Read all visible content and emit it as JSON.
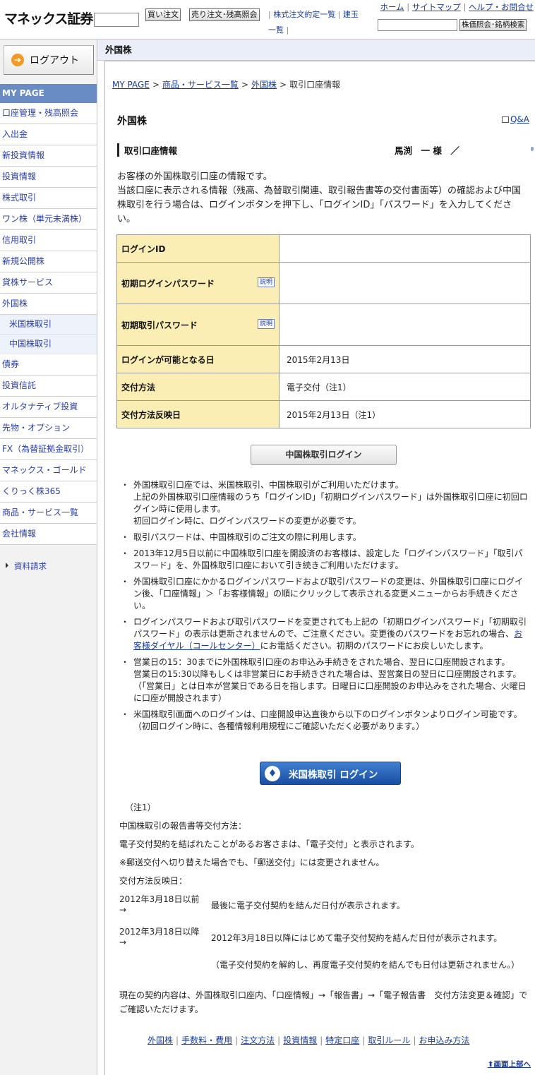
{
  "header": {
    "logo": "マネックス証券",
    "buy_label": "買い注文",
    "sell_label": "売り注文･残高照会",
    "order_list_label": "株式注文約定一覧",
    "contract_label": "建玉一覧",
    "home_label": "ホーム",
    "sitemap_label": "サイトマップ",
    "help_label": "ヘルプ・お問合せ",
    "search_btn_label": "株価照会･銘柄検索"
  },
  "sidebar": {
    "logout_label": "ログアウト",
    "mypage_label": "MY PAGE",
    "items": [
      "口座管理・残高照会",
      "入出金",
      "新投資情報",
      "投資情報",
      "株式取引",
      "ワン株（単元未満株）",
      "信用取引",
      "新規公開株",
      "貸株サービス",
      "外国株"
    ],
    "sub_items": [
      "米国株取引",
      "中国株取引"
    ],
    "items2": [
      "債券",
      "投資信託",
      "オルタナティブ投資",
      "先物・オプション",
      "FX（為替証拠金取引）",
      "マネックス・ゴールド",
      "くりっく株365",
      "商品・サービス一覧",
      "会社情報"
    ],
    "doc_request": "資料請求"
  },
  "section_title": "外国株",
  "breadcrumb": {
    "mypage": "MY PAGE",
    "products": "商品・サービス一覧",
    "foreign": "外国株",
    "current": "取引口座情報",
    "sep": ">"
  },
  "page_title": "外国株",
  "qa_label": "Q&A",
  "sub_title": "取引口座情報",
  "user_name": "馬渕　一 様　／",
  "intro": {
    "line1": "お客様の外国株取引口座の情報です。",
    "line2": "当該口座に表示される情報（残高、為替取引関連、取引報告書等の交付書面等）の確認および中国株取引を行う場合は、ログインボタンを押下し、「ログインID」「パスワード」を入力してください。"
  },
  "table": {
    "login_id_label": "ログインID",
    "init_login_pw_label": "初期ログインパスワード",
    "init_trade_pw_label": "初期取引パスワード",
    "help_label": "説明",
    "login_date_label": "ログインが可能となる日",
    "login_date_value": "2015年2月13日",
    "delivery_label": "交付方法",
    "delivery_value": "電子交付（注1）",
    "delivery_date_label": "交付方法反映日",
    "delivery_date_value": "2015年2月13日（注1）"
  },
  "cn_login_label": "中国株取引ログイン",
  "notes": [
    [
      "外国株取引口座では、米国株取引、中国株取引がご利用いただけます。",
      "上記の外国株取引口座情報のうち「ログインID」「初期ログインパスワード」は外国株取引口座に初回ログイン時に使用します。",
      "初回ログイン時に、ログインパスワードの変更が必要です。"
    ],
    [
      "取引パスワードは、中国株取引のご注文の際に利用します。"
    ],
    [
      "2013年12月5日以前に中国株取引口座を開設済のお客様は、設定した「ログインパスワード」「取引パスワード」を、外国株取引口座において引き続きご利用いただけます。"
    ],
    [
      "外国株取引口座にかかるログインパスワードおよび取引パスワードの変更は、外国株取引口座にログイン後、「口座情報」＞「お客様情報」の順にクリックして表示される変更メニューからお手続きください。"
    ],
    [
      "営業日の15：30までに外国株取引口座のお申込み手続きをされた場合、翌日に口座開設されます。",
      "営業日の15:30以降もしくは非営業日にお手続きされた場合は、翌営業日の翌日に口座開設されます。（「営業日」とは日本が営業日である日を指します。日曜日に口座開設のお申込みをされた場合、火曜日に口座が開設されます）"
    ],
    [
      "米国株取引画面へのログインは、口座開設申込直後から以下のログインボタンよりログイン可能です。（初回ログイン時に、各種情報利用規程にご確認いただく必要があります。）"
    ]
  ],
  "note_pw": {
    "before": "ログインパスワードおよび取引パスワードを変更されても上記の「初期ログインパスワード」「初期取引パスワード」の表示は更新されませんので、ご注意ください。変更後のパスワードをお忘れの場合、",
    "link": "お客様ダイヤル（コールセンター）",
    "after": "にお電話ください。初期のパスワードにお戻しいたします。"
  },
  "us_login_label": "米国株取引 ログイン",
  "footnote": {
    "heading": "（注1）",
    "method_title": "中国株取引の報告書等交付方法：",
    "method_text": "電子交付契約を結ばれたことがあるお客さまは、「電子交付」と表示されます。",
    "method_note": "※郵送交付へ切り替えた場合でも、「郵送交付」には変更されません。",
    "date_title": "交付方法反映日：",
    "date1": "2012年3月18日以前",
    "date1_text": "最後に電子交付契約を結んだ日付が表示されます。",
    "date2": "2012年3月18日以降",
    "date2_text": "2012年3月18日以降にはじめて電子交付契約を結んだ日付が表示されます。",
    "arrow": "→",
    "paren": "（電子交付契約を解約し、再度電子交付契約を結んでも日付は更新されません。）",
    "contract": "現在の契約内容は、外国株取引口座内、「口座情報」→「報告書」→「電子報告書　交付方法変更＆確認」でご確認いただけます。"
  },
  "footer": {
    "links": [
      "外国株",
      "手数料・費用",
      "注文方法",
      "投資情報",
      "特定口座",
      "取引ルール",
      "お申込み方法"
    ],
    "sep": "|",
    "back_top": "画面上部へ"
  }
}
